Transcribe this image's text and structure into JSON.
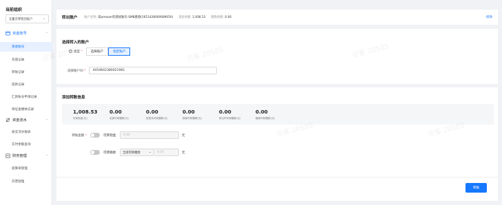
{
  "sidebar": {
    "title": "当前组织",
    "org_select": "宜量云零售团账户",
    "groups": [
      {
        "label": "资金账号",
        "items": [
          "资金账号",
          "充值记录",
          "转账记录",
          "提款记录",
          "汇款账号申请记录",
          "保证金缴纳记录"
        ]
      },
      {
        "label": "资金流水",
        "items": [
          "收支流水报表",
          "实时余额查询"
        ]
      },
      {
        "label": "财务管理",
        "items": [
          "提算单管理",
          "开票管理"
        ]
      }
    ]
  },
  "header": {
    "title": "转出账户",
    "account_name_label": "账户名称:",
    "account_name": "高amaoer的测试账号-SMB香港(1651428000689050)",
    "cash_balance_label": "现金余额:",
    "cash_balance": "1,008.53",
    "bonus_balance_label": "赠款余额:",
    "bonus_balance": "0.00",
    "edit_label": "修改"
  },
  "select_account": {
    "title": "选择转入的账户",
    "type_label": "类型",
    "options": [
      "选择账户",
      "指定账户"
    ],
    "selected": "指定账户",
    "account_id_label": "选择账户ID",
    "account_id": "4454842380021981"
  },
  "transfer_info": {
    "title": "添加转账信息",
    "stats": [
      {
        "value": "1,008.53",
        "label": "可转现金(元)"
      },
      {
        "value": "0.00",
        "label": "全部可转赠款(元)"
      },
      {
        "value": "0.00",
        "label": "信息流可转赠款(元)"
      },
      {
        "value": "0.00",
        "label": "搜索可转赠款(元)"
      },
      {
        "value": "0.00",
        "label": "穿山甲可转赠款(元)"
      },
      {
        "value": "0.00",
        "label": "通用可转赠款(元)"
      }
    ],
    "amount_label": "转账金额",
    "cash_toggle_label": "可转现金",
    "cash_placeholder": "0.00",
    "bonus_toggle_label": "可转赠款",
    "bonus_select": "全部可转赠款",
    "bonus_placeholder": "0.00",
    "unit": "元"
  },
  "submit_label": "转账",
  "watermark": "访客 20585",
  "colors": {
    "accent": "#1677ff",
    "required": "#ff4d4f"
  }
}
